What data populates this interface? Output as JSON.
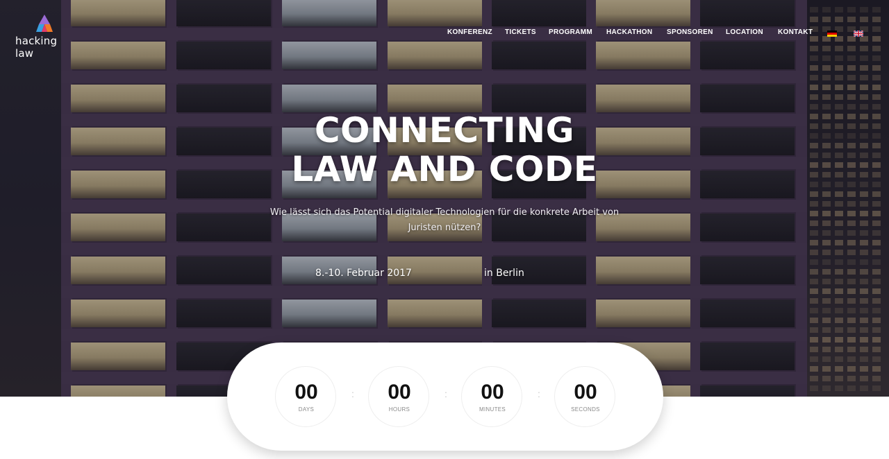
{
  "brand": {
    "logo_text": "hacking law"
  },
  "nav": {
    "items": [
      "KONFERENZ",
      "TICKETS",
      "PROGRAMM",
      "HACKATHON",
      "SPONSOREN",
      "LOCATION",
      "KONTAKT"
    ]
  },
  "hero": {
    "headline_line1": "CONNECTING",
    "headline_line2": "LAW AND CODE",
    "subtitle": "Wie lässt sich das Potential digitaler Technologien für die konkrete Arbeit von Juristen nützen?",
    "date": "8.-10. Februar 2017",
    "location": "in Berlin"
  },
  "countdown": {
    "days": {
      "value": "00",
      "label": "DAYS"
    },
    "hours": {
      "value": "00",
      "label": "HOURS"
    },
    "minutes": {
      "value": "00",
      "label": "MINUTES"
    },
    "seconds": {
      "value": "00",
      "label": "SECONDS"
    },
    "separator": ":"
  },
  "colors": {
    "accent_text": "#ffffff",
    "countdown_bg": "#ffffff"
  }
}
